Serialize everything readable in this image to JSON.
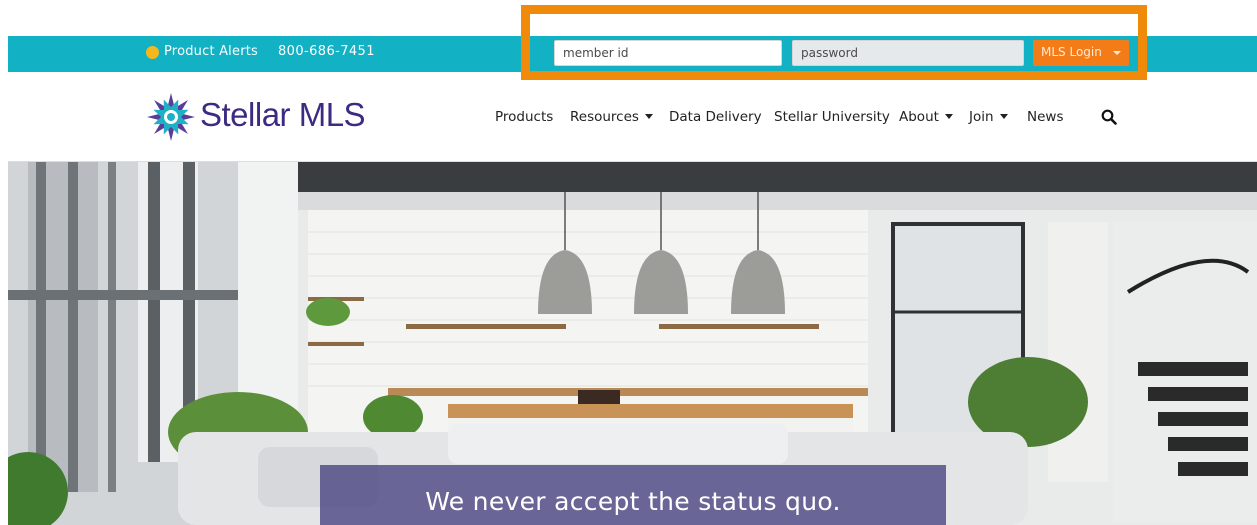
{
  "topbar": {
    "product_alerts": "Product Alerts",
    "phone": "800-686-7451",
    "member_placeholder": "member id",
    "password_placeholder": "password",
    "login_label": "MLS Login",
    "color": "#12b1c4",
    "login_color": "#f47c18"
  },
  "header": {
    "logo_text": "Stellar MLS",
    "logo_color": "#3d2a82",
    "nav": [
      {
        "label": "Products",
        "dropdown": false
      },
      {
        "label": "Resources",
        "dropdown": true
      },
      {
        "label": "Data Delivery",
        "dropdown": false
      },
      {
        "label": "Stellar University",
        "dropdown": false
      },
      {
        "label": "About",
        "dropdown": true
      },
      {
        "label": "Join",
        "dropdown": true
      },
      {
        "label": "News",
        "dropdown": false
      }
    ],
    "search_icon": "search-icon"
  },
  "hero": {
    "tagline": "We never accept the status quo."
  },
  "highlight_color": "#f08a0a"
}
